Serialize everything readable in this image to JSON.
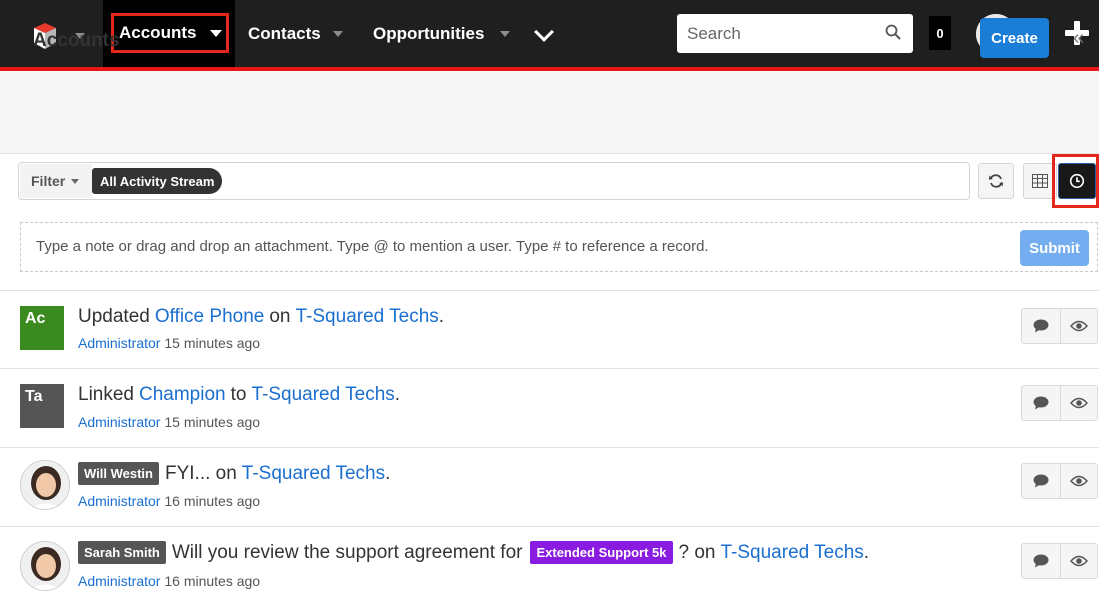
{
  "nav": {
    "items": [
      {
        "label": "Accounts"
      },
      {
        "label": "Contacts"
      },
      {
        "label": "Opportunities"
      }
    ],
    "search_placeholder": "Search",
    "notification_count": "0"
  },
  "header": {
    "title": "Accounts",
    "create_label": "Create"
  },
  "filter": {
    "label": "Filter",
    "selected": "All Activity Stream"
  },
  "note": {
    "placeholder": "Type a note or drag and drop an attachment. Type @ to mention a user. Type # to reference a record.",
    "submit_label": "Submit"
  },
  "colors": {
    "accent": "#e61718",
    "link": "#1a6fd0",
    "primary_button": "#1a7ed7"
  },
  "activities": [
    {
      "avatar_initials": "Ac",
      "avatar_color": "#3b8a1f",
      "verb": "Updated",
      "field": "Office Phone",
      "connector": "on",
      "record": "T-Squared Techs",
      "end": ".",
      "author": "Administrator",
      "time": "15 minutes ago"
    },
    {
      "avatar_initials": "Ta",
      "avatar_color": "#555555",
      "verb": "Linked",
      "field": "Champion",
      "connector": "to",
      "record": "T-Squared Techs",
      "end": ".",
      "author": "Administrator",
      "time": "15 minutes ago"
    },
    {
      "user_tag": "Will Westin",
      "text": "FYI... on",
      "record": "T-Squared Techs",
      "end": ".",
      "author": "Administrator",
      "time": "16 minutes ago"
    },
    {
      "user_tag": "Sarah Smith",
      "text": "Will you review the support agreement for",
      "product_tag": "Extended Support 5k",
      "text_after": "? on",
      "record": "T-Squared Techs",
      "end": ".",
      "author": "Administrator",
      "time": "16 minutes ago"
    }
  ]
}
